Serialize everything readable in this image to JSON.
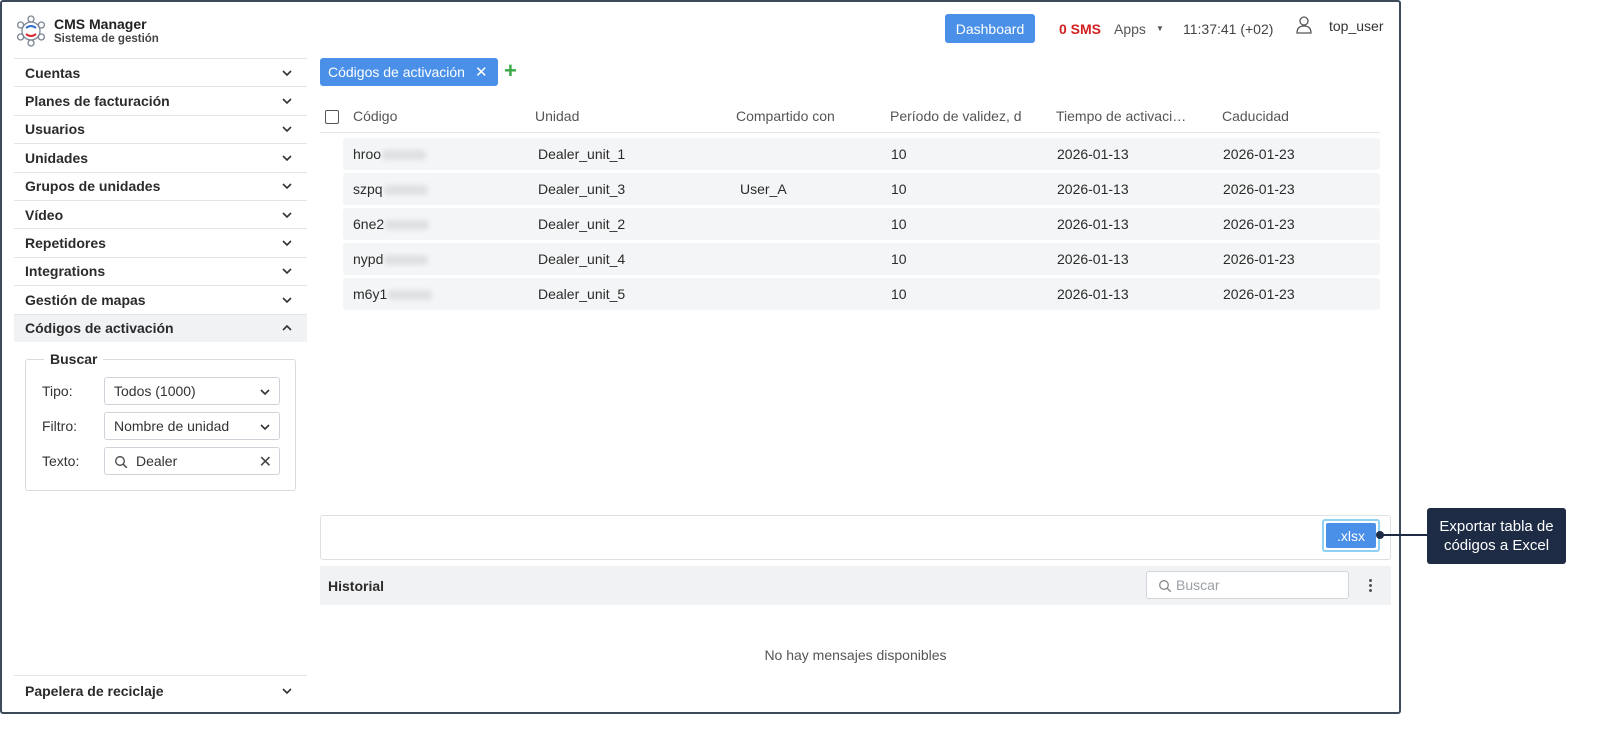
{
  "header": {
    "app_title": "CMS Manager",
    "app_subtitle": "Sistema de gestión",
    "dashboard_label": "Dashboard",
    "sms_label": "0 SMS",
    "apps_label": "Apps",
    "clock": "11:37:41 (+02)",
    "user_name": "top_user"
  },
  "sidebar": {
    "items": [
      {
        "label": "Cuentas"
      },
      {
        "label": "Planes de facturación"
      },
      {
        "label": "Usuarios"
      },
      {
        "label": "Unidades"
      },
      {
        "label": "Grupos de unidades"
      },
      {
        "label": "Vídeo"
      },
      {
        "label": "Repetidores"
      },
      {
        "label": "Integrations"
      },
      {
        "label": "Gestión de mapas"
      },
      {
        "label": "Códigos de activación"
      }
    ],
    "search": {
      "legend": "Buscar",
      "type_label": "Tipo:",
      "type_value": "Todos (1000)",
      "filter_label": "Filtro:",
      "filter_value": "Nombre de unidad",
      "text_label": "Texto:",
      "text_value": "Dealer"
    },
    "trash_label": "Papelera de reciclaje"
  },
  "tabs": {
    "active_label": "Códigos de activación"
  },
  "table": {
    "headers": {
      "code": "Código",
      "unit": "Unidad",
      "shared": "Compartido con",
      "validity": "Período de validez, d",
      "activation": "Tiempo de activaci…",
      "expiry": "Caducidad"
    },
    "rows": [
      {
        "code": "hroo",
        "unit": "Dealer_unit_1",
        "shared": "",
        "validity": "10",
        "activation": "2026-01-13",
        "expiry": "2026-01-23"
      },
      {
        "code": "szpq",
        "unit": "Dealer_unit_3",
        "shared": "User_A",
        "validity": "10",
        "activation": "2026-01-13",
        "expiry": "2026-01-23"
      },
      {
        "code": "6ne2",
        "unit": "Dealer_unit_2",
        "shared": "",
        "validity": "10",
        "activation": "2026-01-13",
        "expiry": "2026-01-23"
      },
      {
        "code": "nypd",
        "unit": "Dealer_unit_4",
        "shared": "",
        "validity": "10",
        "activation": "2026-01-13",
        "expiry": "2026-01-23"
      },
      {
        "code": "m6y1",
        "unit": "Dealer_unit_5",
        "shared": "",
        "validity": "10",
        "activation": "2026-01-13",
        "expiry": "2026-01-23"
      }
    ]
  },
  "export": {
    "xlsx_label": ".xlsx",
    "callout": "Exportar tabla de códigos a Excel"
  },
  "history": {
    "title": "Historial",
    "search_placeholder": "Buscar",
    "empty_message": "No hay mensajes disponibles"
  },
  "colors": {
    "accent": "#4a90e8",
    "sms_red": "#d21f1f",
    "add_green": "#3aa845",
    "callout_bg": "#1d2b45"
  }
}
